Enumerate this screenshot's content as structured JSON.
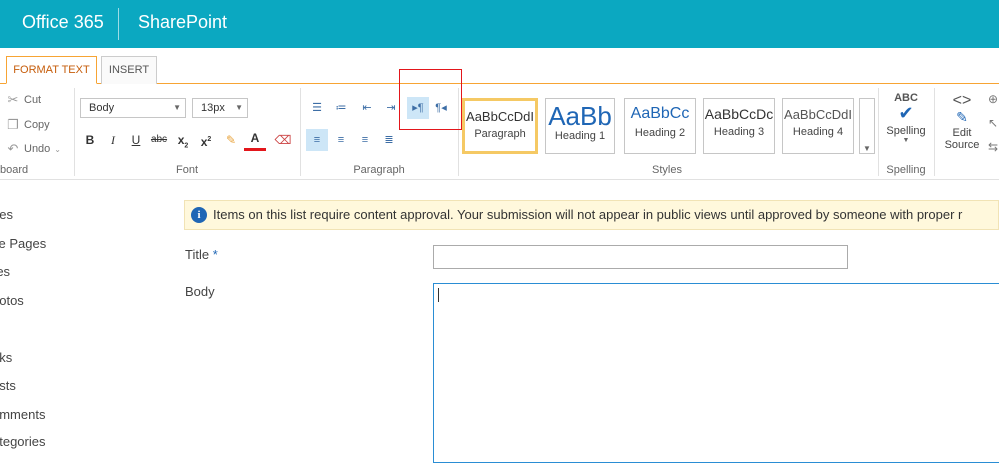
{
  "suite": {
    "brand": "Office 365",
    "app": "SharePoint"
  },
  "tabs": [
    {
      "label": "FORMAT TEXT"
    },
    {
      "label": "INSERT"
    }
  ],
  "clipboard": {
    "cut": "Cut",
    "copy": "Copy",
    "undo": "Undo",
    "group": "board"
  },
  "font": {
    "family": "Body",
    "size": "13px",
    "group": "Font"
  },
  "paragraph": {
    "group": "Paragraph"
  },
  "styles": {
    "group": "Styles",
    "items": [
      {
        "sample": "AaBbCcDdI",
        "name": "Paragraph"
      },
      {
        "sample": "AaBb",
        "name": "Heading 1"
      },
      {
        "sample": "AaBbCc",
        "name": "Heading 2"
      },
      {
        "sample": "AaBbCcDc",
        "name": "Heading 3"
      },
      {
        "sample": "AaBbCcDdI",
        "name": "Heading 4"
      }
    ]
  },
  "spelling": {
    "abc": "ABC",
    "label": "Spelling",
    "group": "Spelling"
  },
  "markup": {
    "label1": "Edit",
    "label2": "Source"
  },
  "nav": [
    "ries",
    "ite Pages",
    "res",
    "hotos",
    "nks",
    "osts",
    "omments",
    "ategories"
  ],
  "info": "Items on this list require content approval. Your submission will not appear in public views until approved by someone with proper r",
  "form": {
    "title_label": "Title",
    "required": "*",
    "body_label": "Body"
  },
  "colors": {
    "suite_bar": "#0ba8c1",
    "accent": "#f7a434",
    "highlight": "#e3161b"
  }
}
